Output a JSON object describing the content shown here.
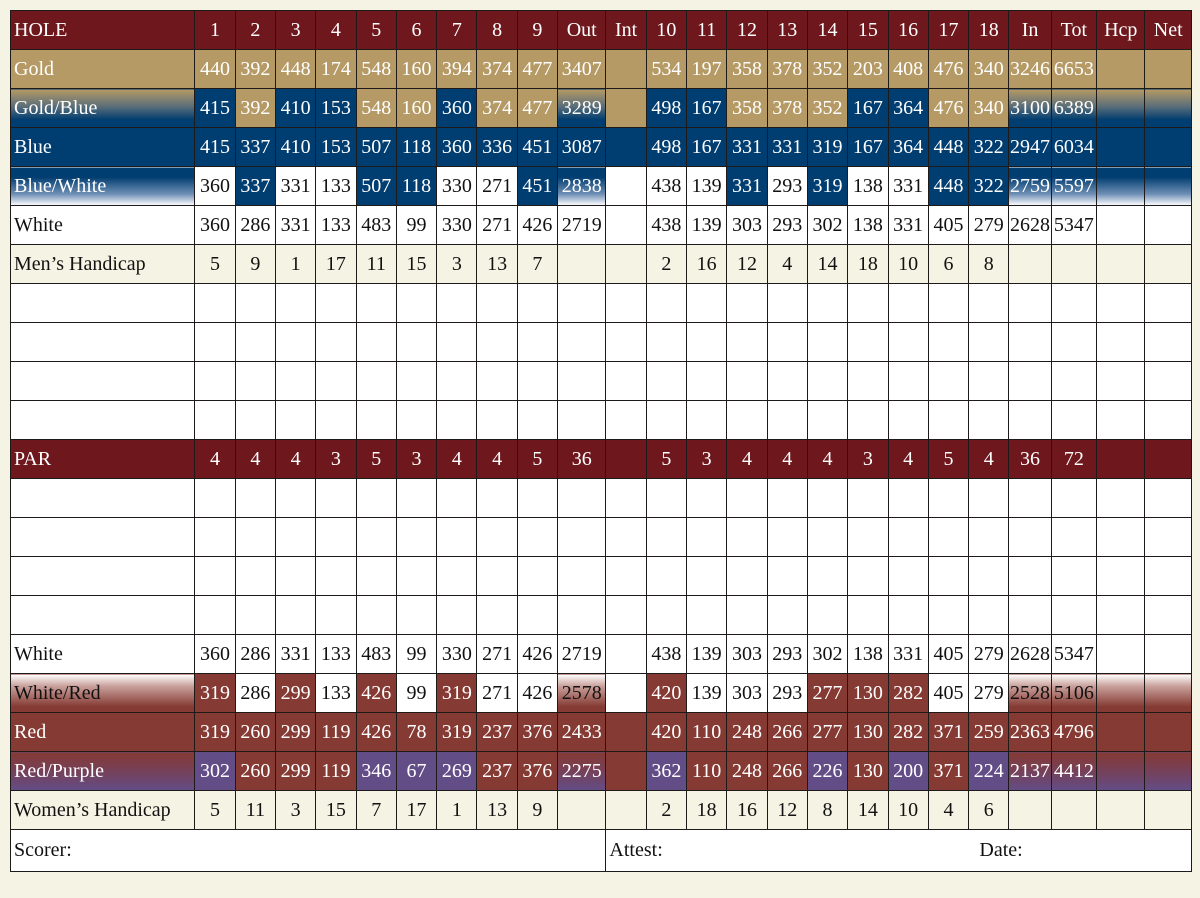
{
  "header": {
    "label": "HOLE",
    "front": [
      "1",
      "2",
      "3",
      "4",
      "5",
      "6",
      "7",
      "8",
      "9"
    ],
    "out": "Out",
    "int": "Int",
    "back": [
      "10",
      "11",
      "12",
      "13",
      "14",
      "15",
      "16",
      "17",
      "18"
    ],
    "in": "In",
    "tot": "Tot",
    "hcp": "Hcp",
    "net": "Net"
  },
  "colors": {
    "header_maroon": "#6e181d",
    "gold": "#b59a65",
    "blue": "#003d70",
    "white": "#ffffff",
    "cream": "#f5f3e3",
    "red": "#853a33",
    "purple": "#634d87"
  },
  "tees": {
    "gold": {
      "label": "Gold",
      "front": [
        "440",
        "392",
        "448",
        "174",
        "548",
        "160",
        "394",
        "374",
        "477"
      ],
      "out": "3407",
      "back": [
        "534",
        "197",
        "358",
        "378",
        "352",
        "203",
        "408",
        "476",
        "340"
      ],
      "in": "3246",
      "tot": "6653"
    },
    "gold_blue": {
      "label": "Gold/Blue",
      "front": [
        "415",
        "392",
        "410",
        "153",
        "548",
        "160",
        "360",
        "374",
        "477"
      ],
      "out": "3289",
      "back": [
        "498",
        "167",
        "358",
        "378",
        "352",
        "167",
        "364",
        "476",
        "340"
      ],
      "in": "3100",
      "tot": "6389"
    },
    "blue": {
      "label": "Blue",
      "front": [
        "415",
        "337",
        "410",
        "153",
        "507",
        "118",
        "360",
        "336",
        "451"
      ],
      "out": "3087",
      "back": [
        "498",
        "167",
        "331",
        "331",
        "319",
        "167",
        "364",
        "448",
        "322"
      ],
      "in": "2947",
      "tot": "6034"
    },
    "blue_white": {
      "label": "Blue/White",
      "front": [
        "360",
        "337",
        "331",
        "133",
        "507",
        "118",
        "330",
        "271",
        "451"
      ],
      "out": "2838",
      "back": [
        "438",
        "139",
        "331",
        "293",
        "319",
        "138",
        "331",
        "448",
        "322"
      ],
      "in": "2759",
      "tot": "5597"
    },
    "white": {
      "label": "White",
      "front": [
        "360",
        "286",
        "331",
        "133",
        "483",
        "99",
        "330",
        "271",
        "426"
      ],
      "out": "2719",
      "back": [
        "438",
        "139",
        "303",
        "293",
        "302",
        "138",
        "331",
        "405",
        "279"
      ],
      "in": "2628",
      "tot": "5347"
    },
    "white_red": {
      "label": "White/Red",
      "front": [
        "319",
        "286",
        "299",
        "133",
        "426",
        "99",
        "319",
        "271",
        "426"
      ],
      "out": "2578",
      "back": [
        "420",
        "139",
        "303",
        "293",
        "277",
        "130",
        "282",
        "405",
        "279"
      ],
      "in": "2528",
      "tot": "5106"
    },
    "red": {
      "label": "Red",
      "front": [
        "319",
        "260",
        "299",
        "119",
        "426",
        "78",
        "319",
        "237",
        "376"
      ],
      "out": "2433",
      "back": [
        "420",
        "110",
        "248",
        "266",
        "277",
        "130",
        "282",
        "371",
        "259"
      ],
      "in": "2363",
      "tot": "4796"
    },
    "red_purple": {
      "label": "Red/Purple",
      "front": [
        "302",
        "260",
        "299",
        "119",
        "346",
        "67",
        "269",
        "237",
        "376"
      ],
      "out": "2275",
      "back": [
        "362",
        "110",
        "248",
        "266",
        "226",
        "130",
        "200",
        "371",
        "224"
      ],
      "in": "2137",
      "tot": "4412"
    }
  },
  "mens_handicap": {
    "label": "Men’s Handicap",
    "front": [
      "5",
      "9",
      "1",
      "17",
      "11",
      "15",
      "3",
      "13",
      "7"
    ],
    "back": [
      "2",
      "16",
      "12",
      "4",
      "14",
      "18",
      "10",
      "6",
      "8"
    ]
  },
  "par": {
    "label": "PAR",
    "front": [
      "4",
      "4",
      "4",
      "3",
      "5",
      "3",
      "4",
      "4",
      "5"
    ],
    "out": "36",
    "back": [
      "5",
      "3",
      "4",
      "4",
      "4",
      "3",
      "4",
      "5",
      "4"
    ],
    "in": "36",
    "tot": "72"
  },
  "womens_handicap": {
    "label": "Women’s Handicap",
    "front": [
      "5",
      "11",
      "3",
      "15",
      "7",
      "17",
      "1",
      "13",
      "9"
    ],
    "back": [
      "2",
      "18",
      "16",
      "12",
      "8",
      "14",
      "10",
      "4",
      "6"
    ]
  },
  "footer": {
    "scorer": "Scorer:",
    "attest": "Attest:",
    "date": "Date:"
  }
}
